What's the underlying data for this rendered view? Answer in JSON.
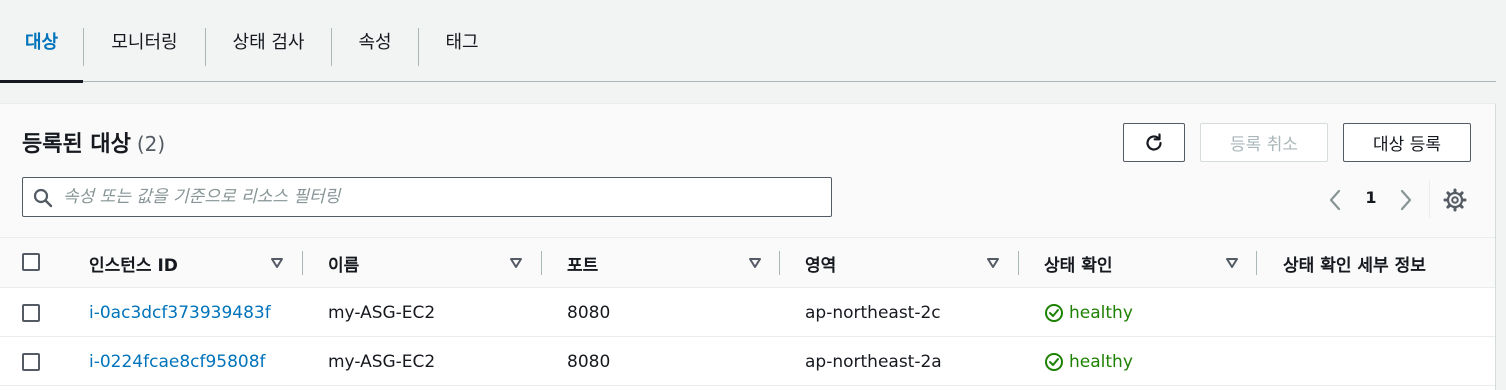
{
  "tabs": [
    {
      "label": "대상",
      "active": true
    },
    {
      "label": "모니터링"
    },
    {
      "label": "상태 검사"
    },
    {
      "label": "속성"
    },
    {
      "label": "태그"
    }
  ],
  "panel": {
    "title": "등록된 대상",
    "count": "(2)",
    "refresh_icon": "refresh-icon",
    "deregister_label": "등록 취소",
    "register_label": "대상 등록",
    "search_placeholder": "속성 또는 값을 기준으로 리소스 필터링",
    "page_number": "1"
  },
  "table": {
    "columns": [
      "인스턴스 ID",
      "이름",
      "포트",
      "영역",
      "상태 확인",
      "상태 확인 세부 정보"
    ],
    "rows": [
      {
        "instance_id": "i-0ac3dcf373939483f",
        "name": "my-ASG-EC2",
        "port": "8080",
        "zone": "ap-northeast-2c",
        "health": "healthy",
        "details": ""
      },
      {
        "instance_id": "i-0224fcae8cf95808f",
        "name": "my-ASG-EC2",
        "port": "8080",
        "zone": "ap-northeast-2a",
        "health": "healthy",
        "details": ""
      }
    ]
  },
  "colors": {
    "accent": "#0073bb",
    "healthy": "#1d8102",
    "text": "#16191f"
  }
}
